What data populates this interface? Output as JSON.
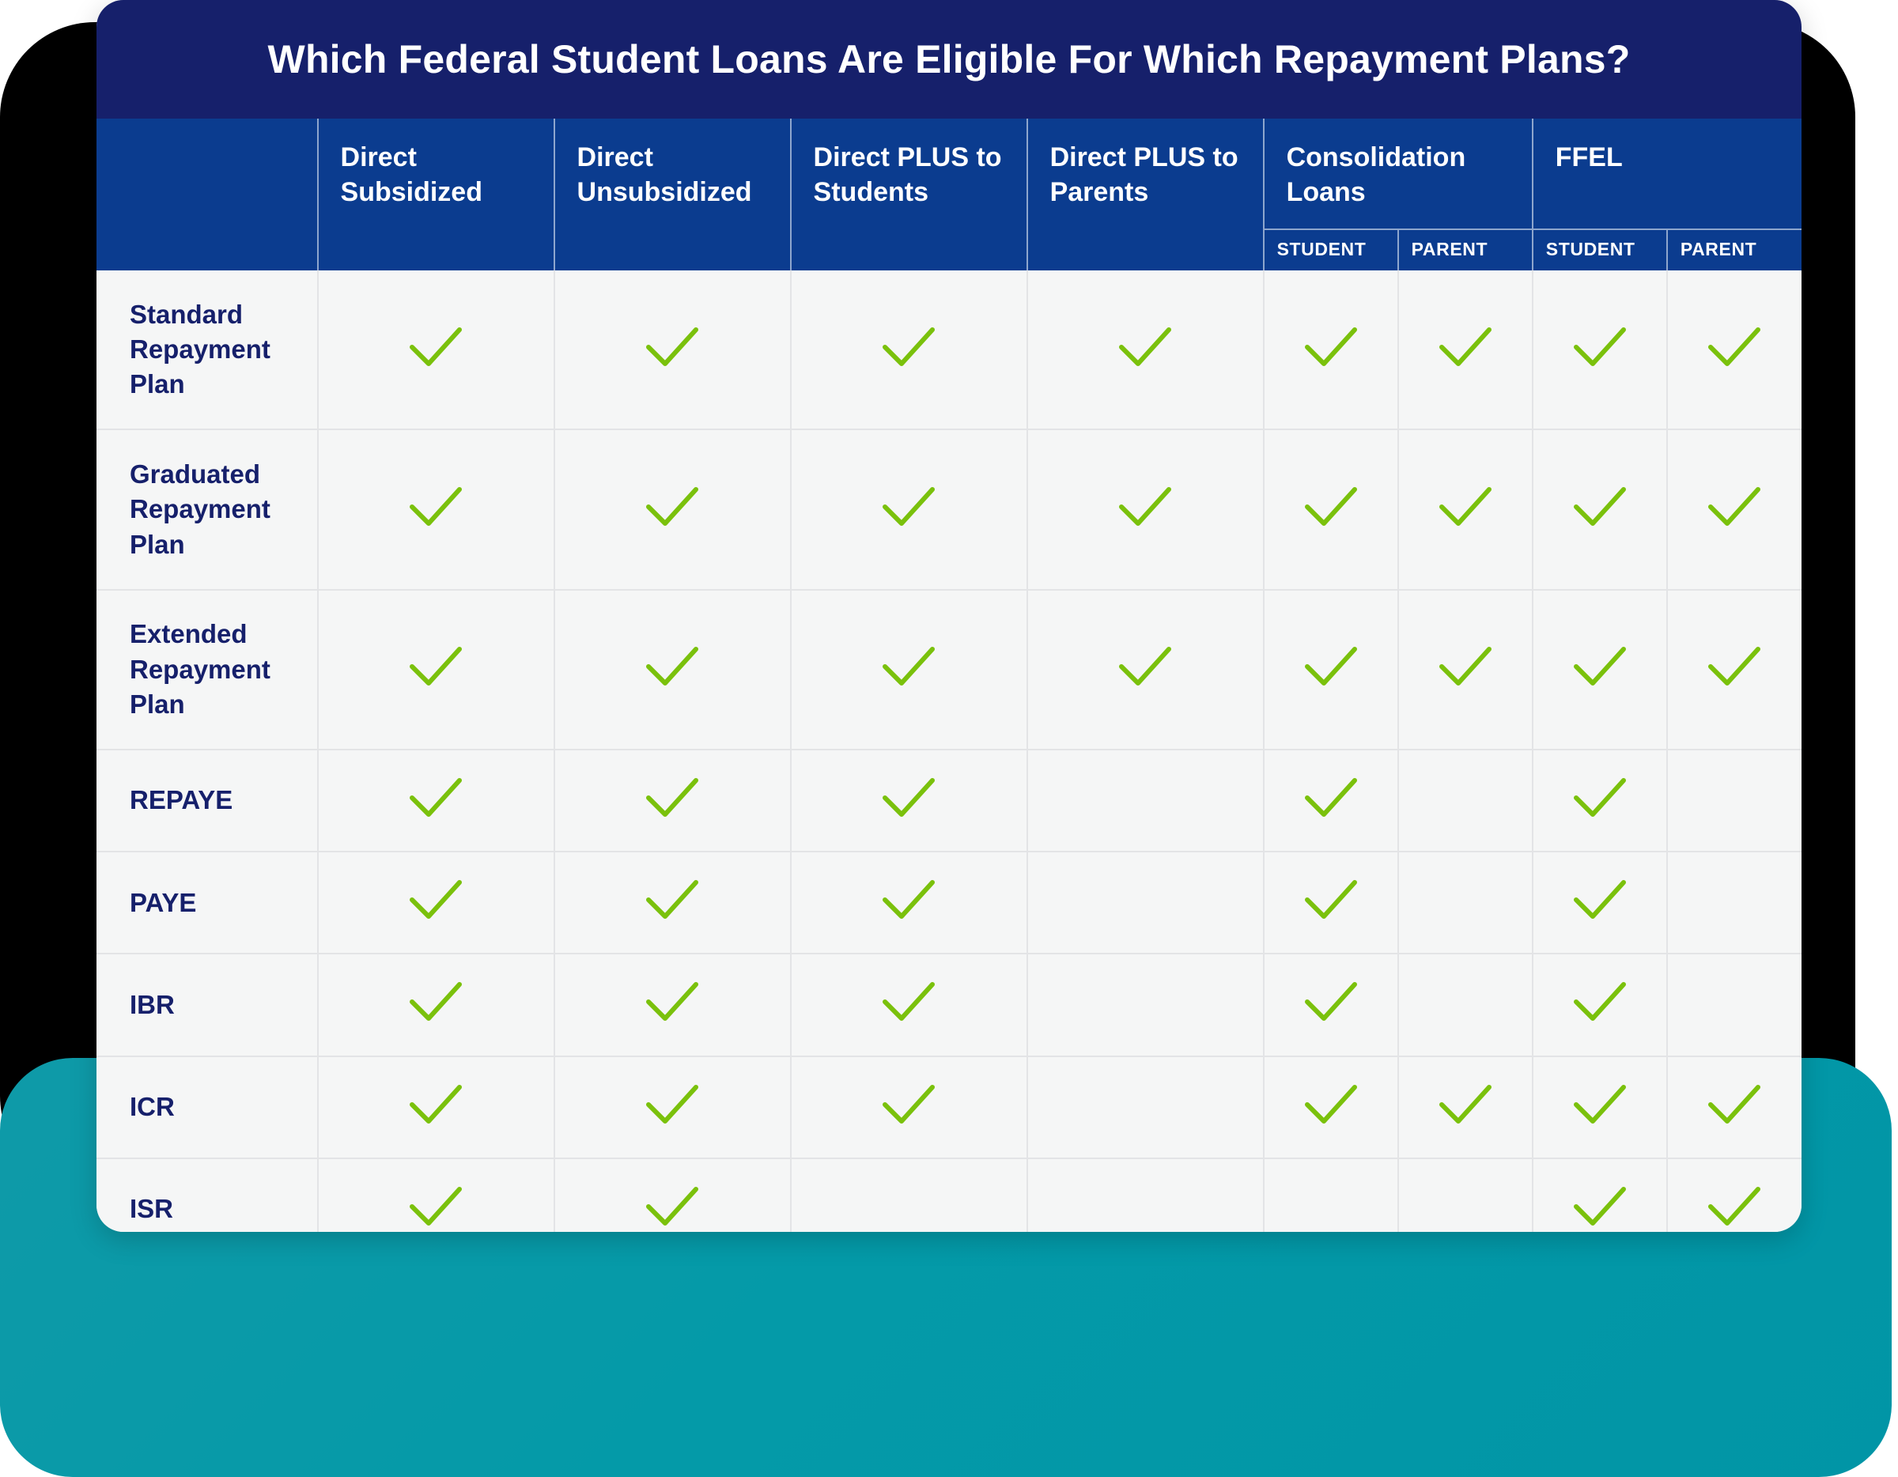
{
  "title": "Which Federal Student Loans Are Eligible For Which Repayment Plans?",
  "colors": {
    "title_bar": "#16206b",
    "header_row": "#0b3c8f",
    "check_green": "#7ac10c",
    "card_bg": "#f5f6f6",
    "accent_teal": "#049aa8",
    "label_navy": "#16206b"
  },
  "columns": {
    "row_label_header": "",
    "groups": [
      {
        "label": "Direct Subsidized",
        "subs": []
      },
      {
        "label": "Direct Unsubsidized",
        "subs": []
      },
      {
        "label": "Direct PLUS to Students",
        "subs": []
      },
      {
        "label": "Direct PLUS to Parents",
        "subs": []
      },
      {
        "label": "Consolidation Loans",
        "subs": [
          "STUDENT",
          "PARENT"
        ]
      },
      {
        "label": "FFEL",
        "subs": [
          "STUDENT",
          "PARENT"
        ]
      }
    ],
    "flat": [
      "Direct Subsidized",
      "Direct Unsubsidized",
      "Direct PLUS to Students",
      "Direct PLUS to Parents",
      "Consolidation Loans STUDENT",
      "Consolidation Loans PARENT",
      "FFEL STUDENT",
      "FFEL PARENT"
    ]
  },
  "rows": [
    {
      "label": "Standard Repayment Plan",
      "size": "tall",
      "cells": [
        true,
        true,
        true,
        true,
        true,
        true,
        true,
        true
      ]
    },
    {
      "label": "Graduated Repayment Plan",
      "size": "tall",
      "cells": [
        true,
        true,
        true,
        true,
        true,
        true,
        true,
        true
      ]
    },
    {
      "label": "Extended Repayment Plan",
      "size": "tall",
      "cells": [
        true,
        true,
        true,
        true,
        true,
        true,
        true,
        true
      ]
    },
    {
      "label": "REPAYE",
      "size": "short",
      "cells": [
        true,
        true,
        true,
        false,
        true,
        false,
        true,
        false
      ]
    },
    {
      "label": "PAYE",
      "size": "short",
      "cells": [
        true,
        true,
        true,
        false,
        true,
        false,
        true,
        false
      ]
    },
    {
      "label": "IBR",
      "size": "short",
      "cells": [
        true,
        true,
        true,
        false,
        true,
        false,
        true,
        false
      ]
    },
    {
      "label": "ICR",
      "size": "short",
      "cells": [
        true,
        true,
        true,
        false,
        true,
        true,
        true,
        true
      ]
    },
    {
      "label": "ISR",
      "size": "short",
      "cells": [
        true,
        true,
        false,
        false,
        false,
        false,
        true,
        true
      ]
    }
  ],
  "icons": {
    "check": "check-icon"
  }
}
